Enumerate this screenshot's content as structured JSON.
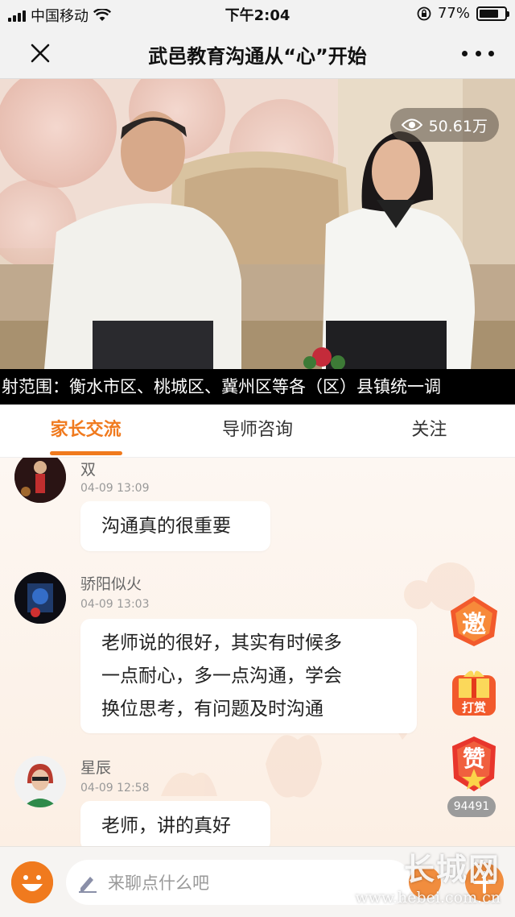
{
  "status_bar": {
    "carrier": "中国移动",
    "time": "下午2:04",
    "battery_percent": "77%",
    "battery_level": 0.77
  },
  "nav": {
    "title": "武邑教育沟通从“心”开始",
    "close_icon": "close-icon",
    "more_icon": "more-dots-icon"
  },
  "video": {
    "views": "50.61万",
    "ticker": "射范围：衡水市区、桃城区、冀州区等各（区）县镇统一调"
  },
  "tabs": [
    {
      "label": "家长交流",
      "active": true
    },
    {
      "label": "导师咨询",
      "active": false
    },
    {
      "label": "关注",
      "active": false
    }
  ],
  "messages": [
    {
      "name": "双",
      "time": "04-09 13:09",
      "text": "沟通真的很重要"
    },
    {
      "name": "骄阳似火",
      "time": "04-09 13:03",
      "lines": [
        "老师说的很好，其实有时候多",
        "一点耐心，多一点沟通，学会",
        "换位思考，有问题及时沟通"
      ]
    },
    {
      "name": "星辰",
      "time": "04-09 12:58",
      "text": "老师，讲的真好"
    }
  ],
  "float_buttons": {
    "invite": "邀",
    "reward": "打赏",
    "like": "赞",
    "like_count": "94491"
  },
  "input": {
    "placeholder": "来聊点什么吧"
  },
  "watermark": {
    "brand": "长城网",
    "url": "www.hebei.com.cn"
  },
  "colors": {
    "accent": "#f07a1e",
    "status_bar_bg": "#f2f2f2"
  }
}
